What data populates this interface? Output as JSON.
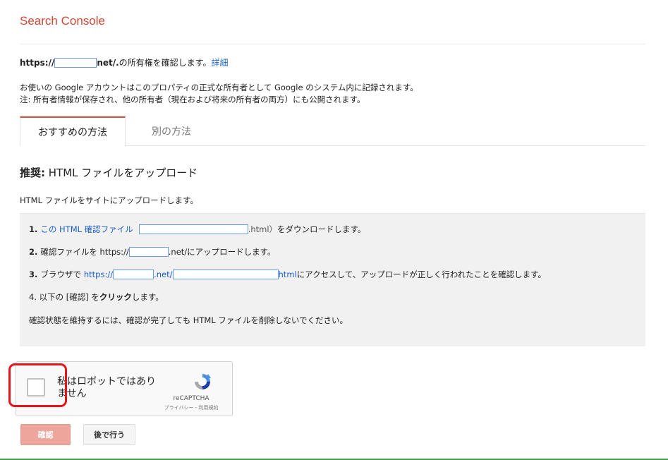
{
  "app": {
    "title": "Search Console"
  },
  "ownership": {
    "url_prefix": "https://",
    "url_suffix": "net/.",
    "text": " の所有権を確認します。",
    "details_link": "詳細",
    "desc_line1": "お使いの Google アカウントはこのプロパティの正式な所有者として Google のシステム内に記録されます。",
    "desc_line2": "注: 所有者情報が保存され、他の所有者（現在および将来の所有者の両方）にも公開されます。"
  },
  "tabs": [
    {
      "label": "おすすめの方法",
      "active": true
    },
    {
      "label": "別の方法",
      "active": false
    }
  ],
  "section": {
    "title_bold": "推奨:",
    "title_rest": " HTML ファイルをアップロード",
    "subtitle": "HTML ファイルをサイトにアップロードします。"
  },
  "steps": {
    "s1_num": "1.",
    "s1_link": "この HTML 確認ファイル",
    "s1_ext": ".html）",
    "s1_rest": "をダウンロードします。",
    "s2_num": "2.",
    "s2_pre": "確認ファイルを https://",
    "s2_mid": ".net/",
    "s2_rest": " にアップロードします。",
    "s3_num": "3.",
    "s3_pre": "ブラウザで",
    "s3_link1": "https://",
    "s3_link2": ".net/",
    "s3_link3": "html",
    "s3_rest": " にアクセスして、アップロードが正しく行われたことを確認します。",
    "s4_pre": "4. 以下の [確認] を",
    "s4_bold": "クリック",
    "s4_post": "します。",
    "note": "確認状態を維持するには、確認が完了しても HTML ファイルを削除しないでください。"
  },
  "recaptcha": {
    "label": "私はロボットではありません",
    "brand": "reCAPTCHA",
    "terms": "プライバシー - 利用規約"
  },
  "buttons": {
    "confirm": "確認",
    "later": "後で行う"
  },
  "colors": {
    "brand": "#d14836",
    "link": "#1a5fc9",
    "tab_accent": "#dd4b39",
    "highlight": "#e8141b",
    "confirm_button": "#eea69c"
  }
}
